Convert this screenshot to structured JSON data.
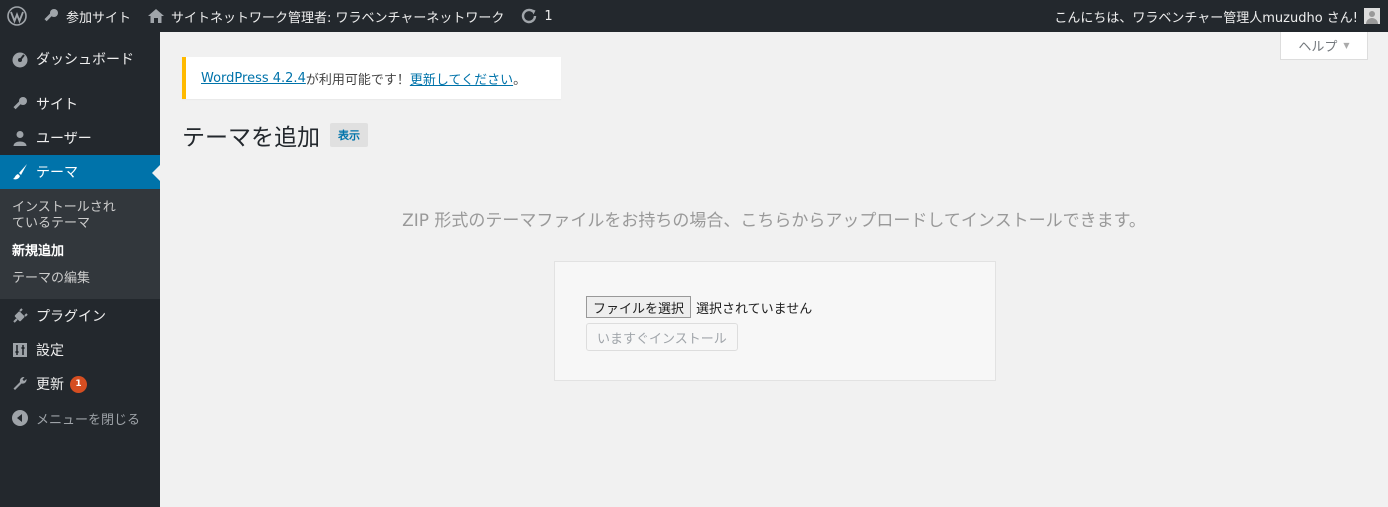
{
  "adminbar": {
    "my_sites": "参加サイト",
    "network_admin": "サイトネットワーク管理者: ワラベンチャーネットワーク",
    "updates_count": "1",
    "greeting": "こんにちは、ワラベンチャー管理人muzudho さん!"
  },
  "sidebar": {
    "items": [
      {
        "label": "ダッシュボード",
        "icon": "dashboard-icon"
      },
      {
        "label": "サイト",
        "icon": "sites-icon"
      },
      {
        "label": "ユーザー",
        "icon": "users-icon"
      },
      {
        "label": "テーマ",
        "icon": "themes-icon"
      },
      {
        "label": "プラグイン",
        "icon": "plugins-icon"
      },
      {
        "label": "設定",
        "icon": "settings-icon"
      },
      {
        "label": "更新",
        "icon": "updates-icon",
        "badge": "1"
      }
    ],
    "submenu": [
      "インストールされているテーマ",
      "新規追加",
      "テーマの編集"
    ],
    "collapse": "メニューを閉じる"
  },
  "help_tab": "ヘルプ",
  "notice": {
    "version_link": "WordPress 4.2.4",
    "text_middle": " が利用可能です！",
    "update_link": "更新してください",
    "text_end": "。"
  },
  "page": {
    "title": "テーマを追加",
    "browse_button": "表示"
  },
  "upload": {
    "description": "ZIP 形式のテーマファイルをお持ちの場合、こちらからアップロードしてインストールできます。",
    "file_button": "ファイルを選択",
    "file_status": "選択されていません",
    "install_button": "いますぐインストール"
  },
  "colors": {
    "adminbar_bg": "#23282d",
    "menu_current": "#0073aa",
    "notice_border": "#ffba00",
    "badge": "#d54e21"
  }
}
